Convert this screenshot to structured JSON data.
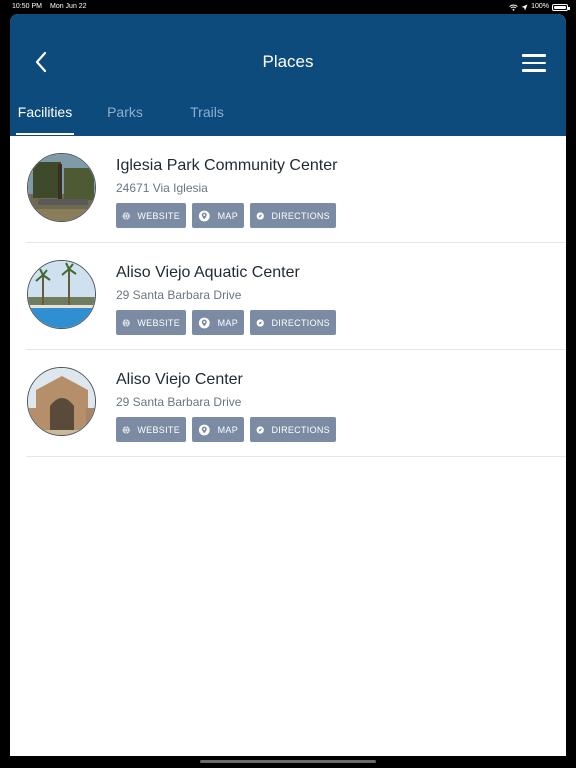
{
  "status_bar": {
    "time": "10:50 PM",
    "date": "Mon Jun 22",
    "battery": "100%"
  },
  "header": {
    "title": "Places",
    "back_icon": "chevron-left-icon",
    "menu_icon": "hamburger-menu-icon"
  },
  "tabs": [
    {
      "label": "Facilities",
      "active": true
    },
    {
      "label": "Parks",
      "active": false
    },
    {
      "label": "Trails",
      "active": false
    }
  ],
  "places": [
    {
      "name": "Iglesia Park Community Center",
      "address": "24671 Via Iglesia"
    },
    {
      "name": "Aliso Viejo Aquatic Center",
      "address": "29 Santa Barbara Drive"
    },
    {
      "name": "Aliso Viejo Center",
      "address": "29 Santa Barbara Drive"
    }
  ],
  "actions": {
    "website": "WEBSITE",
    "map": "MAP",
    "directions": "DIRECTIONS"
  },
  "colors": {
    "header_bg": "#0c4b7c",
    "tab_inactive": "#8fb0cc",
    "action_button_bg": "#7a8ba3"
  }
}
